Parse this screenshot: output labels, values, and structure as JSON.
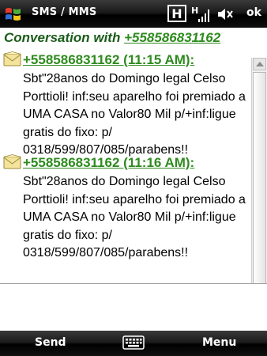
{
  "titlebar": {
    "app_title": "SMS / MMS",
    "ok_label": "ok",
    "status_icon_letter": "H",
    "signal_letter": "H",
    "start_icon": "windows-flag-icon",
    "speaker_icon": "speaker-muted-icon"
  },
  "conversation": {
    "header_prefix": "Conversation with ",
    "header_number": "+558586831162",
    "messages": [
      {
        "sender": "+558586831162 (11:15 AM):",
        "body": "Sbt\"28anos do Domingo legal Celso Porttioli! inf:seu aparelho foi premiado a UMA CASA no Valor80 Mil p/+inf:ligue gratis do fixo: p/ 0318/599/807/085/parabens!!"
      },
      {
        "sender": "+558586831162 (11:16 AM):",
        "body": "Sbt\"28anos do Domingo legal Celso Porttioli! inf:seu aparelho foi premiado a UMA CASA no Valor80 Mil p/+inf:ligue gratis do fixo: p/ 0318/599/807/085/parabens!!"
      }
    ]
  },
  "compose": {
    "value": "",
    "placeholder": ""
  },
  "softkeys": {
    "left_label": "Send",
    "right_label": "Menu",
    "center_icon": "keyboard-icon"
  },
  "colors": {
    "sender_green": "#2e8b1e",
    "header_green": "#1a5c1a",
    "bar_black": "#000000"
  }
}
